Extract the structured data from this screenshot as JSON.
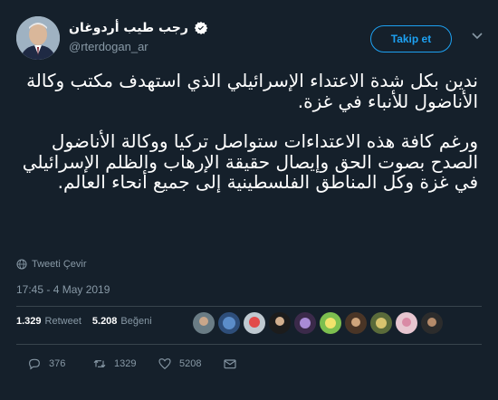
{
  "header": {
    "display_name": "رجب طيب أردوغان",
    "handle": "@rterdogan_ar",
    "follow_label": "Takip et"
  },
  "tweet": {
    "paragraph_1": "ندين بكل شدة الاعتداء الإسرائيلي الذي استهدف مكتب وكالة الأناضول للأنباء في غزة.",
    "paragraph_2": "ورغم كافة هذه الاعتداءات ستواصل تركيا ووكالة الأناضول الصدح بصوت الحق وإيصال حقيقة الإرهاب والظلم الإسرائيلي في غزة وكل المناطق الفلسطينية إلى جميع أنحاء العالم."
  },
  "translate_label": "Tweeti Çevir",
  "timestamp": "17:45 - 4 May 2019",
  "stats": {
    "retweets_count": "1.329",
    "retweets_label": "Retweet",
    "likes_count": "5.208",
    "likes_label": "Beğeni"
  },
  "actions": {
    "reply_count": "376",
    "retweet_count": "1329",
    "like_count": "5208"
  },
  "colors": {
    "background": "#15202b",
    "accent": "#1da1f2",
    "muted": "#8899a6",
    "divider": "#38444d"
  }
}
